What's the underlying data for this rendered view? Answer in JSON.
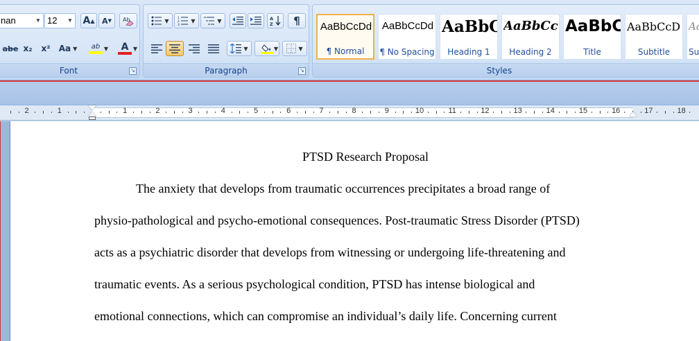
{
  "ribbon": {
    "font": {
      "label": "Font",
      "font_name": "nan",
      "font_size": "12",
      "grow_font": "A",
      "shrink_font": "A",
      "strikethrough": "abe",
      "subscript": "x₂",
      "superscript": "x²",
      "change_case": "Aa",
      "highlight": "ab",
      "font_color": "A",
      "highlight_color": "#ffff00",
      "font_color_value": "#e02020"
    },
    "paragraph": {
      "label": "Paragraph",
      "show_marks": "¶"
    },
    "styles": {
      "label": "Styles",
      "items": [
        {
          "sample": "AaBbCcDd",
          "name": "¶ Normal"
        },
        {
          "sample": "AaBbCcDd",
          "name": "¶ No Spacing"
        },
        {
          "sample": "AaBbC",
          "name": "Heading 1"
        },
        {
          "sample": "AaBbCc",
          "name": "Heading 2"
        },
        {
          "sample": "AaBbC",
          "name": "Title"
        },
        {
          "sample": "AaBbCcD",
          "name": "Subtitle"
        },
        {
          "sample": "Aa",
          "name": "Sub"
        }
      ]
    }
  },
  "ruler": {
    "labels": [
      "2",
      "1",
      "1",
      "2",
      "3",
      "4",
      "5",
      "6",
      "7",
      "8",
      "9",
      "10",
      "11",
      "12",
      "13",
      "14",
      "15",
      "16",
      "17",
      "18"
    ]
  },
  "document": {
    "title": "PTSD Research Proposal",
    "lines": [
      "The anxiety that develops from traumatic occurrences precipitates a broad range of",
      "physio-pathological and psycho-emotional consequences. Post-traumatic Stress Disorder (PTSD)",
      "acts as a psychiatric disorder that develops from witnessing or undergoing life-threatening and",
      "traumatic events. As a serious psychological condition, PTSD has intense biological and",
      "emotional connections, which can compromise an individual’s daily life. Concerning current"
    ]
  },
  "colors": {
    "accent_border": "#d43a3a",
    "ribbon_text": "#15428b",
    "active_style": "#f0b14a"
  }
}
